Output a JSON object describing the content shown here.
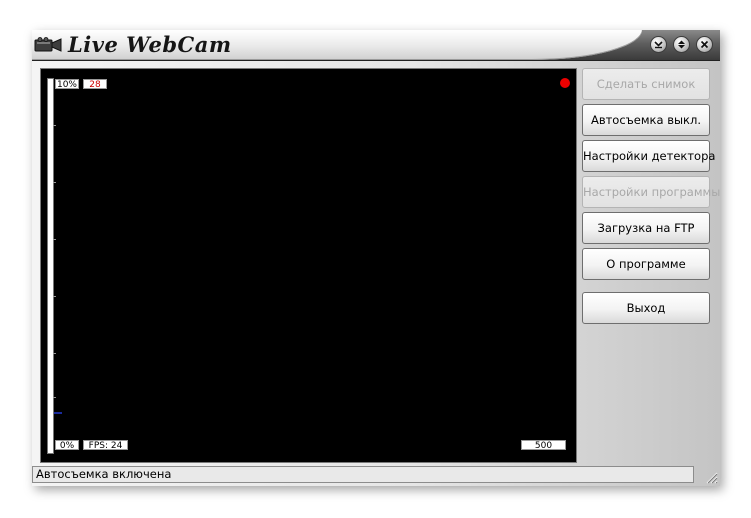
{
  "window": {
    "title": "Live WebCam",
    "controls": {
      "minimize_icon": "chevron-down-icon",
      "restore_icon": "up-down-icon",
      "close_icon": "close-icon"
    }
  },
  "video": {
    "top_left_percent": "10%",
    "top_left_value": "28",
    "bottom_left_percent": "0%",
    "fps": "FPS: 24",
    "bottom_right_value": "500",
    "recording_indicator_color": "#ee0000",
    "top_left_value_color": "#cc0000"
  },
  "buttons": [
    {
      "label": "Сделать снимок",
      "enabled": false
    },
    {
      "label": "Автосъемка выкл.",
      "enabled": true
    },
    {
      "label": "Настройки детектора",
      "enabled": true
    },
    {
      "label": "Настройки программы",
      "enabled": false
    },
    {
      "label": "Загрузка на FTP",
      "enabled": true
    },
    {
      "label": "О программе",
      "enabled": true
    },
    {
      "label": "Выход",
      "enabled": true
    }
  ],
  "status": {
    "text": "Автосъемка включена"
  }
}
